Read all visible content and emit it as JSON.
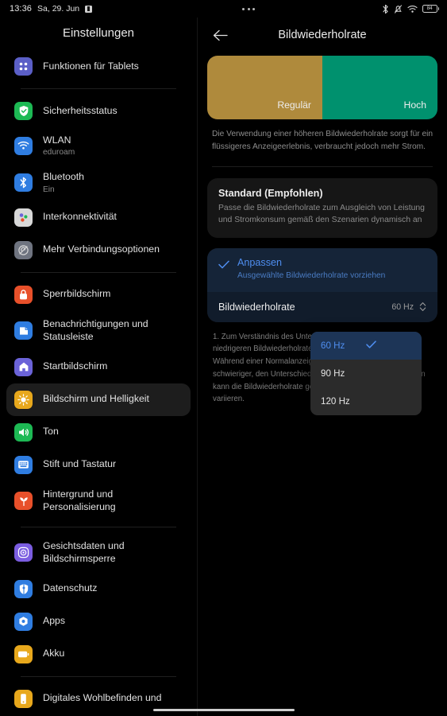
{
  "statusbar": {
    "time": "13:36",
    "date": "Sa, 29. Jun",
    "mini_icon": "screenshot-icon",
    "overflow_icon": "more-dots-icon",
    "icons": [
      "bluetooth-icon",
      "bell-muted-icon",
      "wifi-icon",
      "battery-icon"
    ],
    "battery_level": "84"
  },
  "sidebar": {
    "title": "Einstellungen",
    "items": [
      {
        "label": "Funktionen für Tablets",
        "sub": "",
        "icon": "tablet-features-icon",
        "icon_color": "#5b5fc7",
        "selected": false,
        "divider_after": true
      },
      {
        "label": "Sicherheitsstatus",
        "sub": "",
        "icon": "shield-check-icon",
        "icon_color": "#1db954",
        "selected": false,
        "divider_after": false
      },
      {
        "label": "WLAN",
        "sub": "eduroam",
        "icon": "wifi-icon",
        "icon_color": "#2f7de1",
        "selected": false,
        "divider_after": false
      },
      {
        "label": "Bluetooth",
        "sub": "Ein",
        "icon": "bluetooth-icon",
        "icon_color": "#2f7de1",
        "selected": false,
        "divider_after": false
      },
      {
        "label": "Interkonnektivität",
        "sub": "",
        "icon": "interconnect-icon",
        "icon_color": "#d8d8d8",
        "selected": false,
        "divider_after": false
      },
      {
        "label": "Mehr Verbindungsoptionen",
        "sub": "",
        "icon": "more-connections-icon",
        "icon_color": "#6f7480",
        "selected": false,
        "divider_after": true
      },
      {
        "label": "Sperrbildschirm",
        "sub": "",
        "icon": "lock-icon",
        "icon_color": "#e8502a",
        "selected": false,
        "divider_after": false
      },
      {
        "label": "Benachrichtigungen und Statusleiste",
        "sub": "",
        "icon": "notifications-icon",
        "icon_color": "#2f7de1",
        "selected": false,
        "divider_after": false
      },
      {
        "label": "Startbildschirm",
        "sub": "",
        "icon": "home-icon",
        "icon_color": "#6b63d8",
        "selected": false,
        "divider_after": false
      },
      {
        "label": "Bildschirm und Helligkeit",
        "sub": "",
        "icon": "brightness-icon",
        "icon_color": "#e8a81c",
        "selected": true,
        "divider_after": false
      },
      {
        "label": "Ton",
        "sub": "",
        "icon": "speaker-icon",
        "icon_color": "#1db954",
        "selected": false,
        "divider_after": false
      },
      {
        "label": "Stift und Tastatur",
        "sub": "",
        "icon": "keyboard-icon",
        "icon_color": "#2f7de1",
        "selected": false,
        "divider_after": false
      },
      {
        "label": "Hintergrund und Personalisierung",
        "sub": "",
        "icon": "wallpaper-icon",
        "icon_color": "#e8502a",
        "selected": false,
        "divider_after": true
      },
      {
        "label": "Gesichtsdaten und Bildschirmsperre",
        "sub": "",
        "icon": "face-unlock-icon",
        "icon_color": "#7b5de0",
        "selected": false,
        "divider_after": false
      },
      {
        "label": "Datenschutz",
        "sub": "",
        "icon": "privacy-icon",
        "icon_color": "#2f7de1",
        "selected": false,
        "divider_after": false
      },
      {
        "label": "Apps",
        "sub": "",
        "icon": "apps-icon",
        "icon_color": "#2f7de1",
        "selected": false,
        "divider_after": false
      },
      {
        "label": "Akku",
        "sub": "",
        "icon": "battery-icon",
        "icon_color": "#e8a81c",
        "selected": false,
        "divider_after": true
      },
      {
        "label": "Digitales Wohlbefinden und",
        "sub": "",
        "icon": "wellbeing-icon",
        "icon_color": "#e8a81c",
        "selected": false,
        "divider_after": false
      }
    ]
  },
  "detail": {
    "back_icon": "back-arrow-icon",
    "title": "Bildwiederholrate",
    "banner": {
      "left_label": "Regulär",
      "right_label": "Hoch",
      "left_color": "#af8a3c",
      "right_color": "#00916e"
    },
    "note": "Die Verwendung einer höheren Bildwiederholrate sorgt für ein flüssigeres Anzeigeerlebnis, verbraucht jedoch mehr Strom.",
    "standard_card": {
      "title": "Standard (Empfohlen)",
      "subtitle": "Passe die Bildwiederholrate zum Ausgleich von Leistung und Stromkonsum gemäß den Szenarien dynamisch an"
    },
    "custom_option": {
      "title": "Anpassen",
      "subtitle": "Ausgewählte Bildwiederholrate vorziehen",
      "check_icon": "check-icon",
      "accent_color": "#4f8ef0"
    },
    "rate_row": {
      "label": "Bildwiederholrate",
      "value": "60 Hz",
      "stepper_icon": "chevron-updown-icon"
    },
    "fineprint": "1. Zum Verständnis des Unterschieds werden Videos mit niedrigeren Bildwiederholrate wiedergegeben und abgespielt. Während einer Normalanzeige ist es möglicherweise schwieriger, den Unterschied zu erkennen. 2. In einigen Fällen kann die Bildwiederholrate gemäß der angezeigten Elemente variieren.",
    "dropdown": {
      "options": [
        {
          "label": "60 Hz",
          "selected": true
        },
        {
          "label": "90 Hz",
          "selected": false
        },
        {
          "label": "120 Hz",
          "selected": false
        }
      ],
      "check_icon": "check-icon"
    }
  },
  "nav_handle": "home-indicator"
}
